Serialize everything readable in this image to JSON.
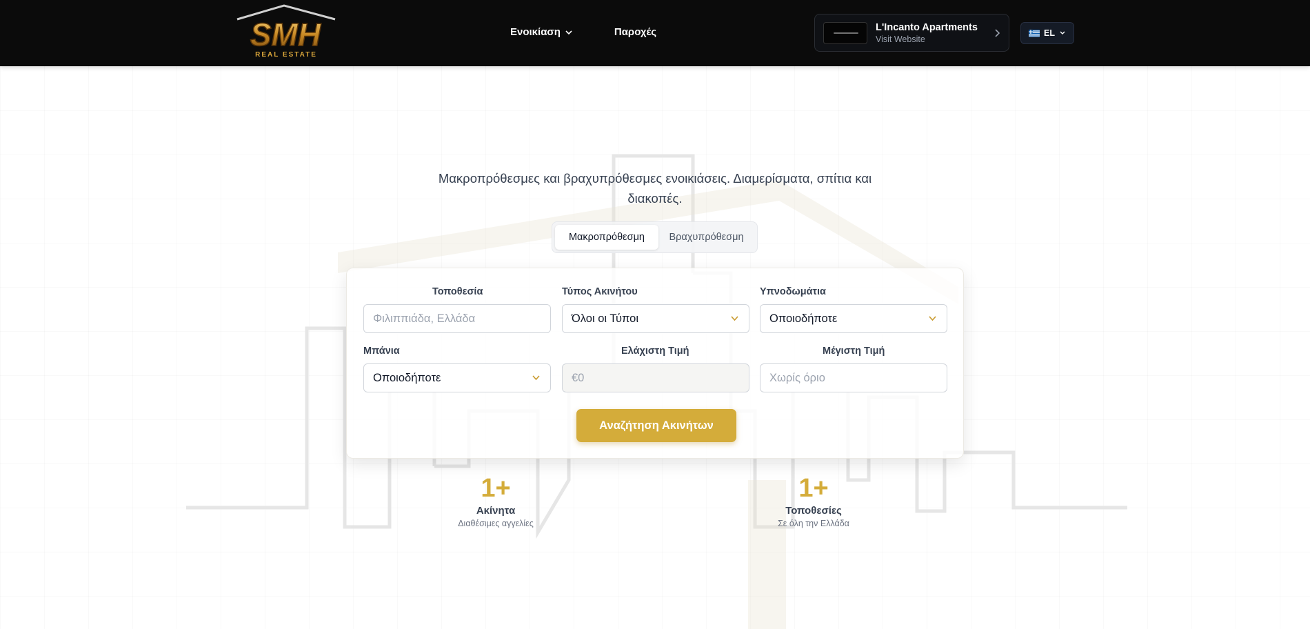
{
  "header": {
    "logo": {
      "text": "SMH",
      "subtitle": "REAL ESTATE"
    },
    "nav": [
      {
        "label": "Ενοικίαση",
        "has_dropdown": true
      },
      {
        "label": "Παροχές",
        "has_dropdown": false
      }
    ],
    "partner": {
      "title": "L'Incanto Apartments",
      "subtitle": "Visit Website",
      "icon": "chevron-right-icon"
    },
    "language": {
      "code": "EL",
      "flag": "greece-flag-icon"
    }
  },
  "hero": {
    "subtitle": "Μακροπρόθεσμες και βραχυπρόθεσμες ενοικιάσεις. Διαμερίσματα, σπίτια και διακοπές."
  },
  "tabs": [
    {
      "label": "Μακροπρόθεσμη",
      "active": true
    },
    {
      "label": "Βραχυπρόθεσμη",
      "active": false
    }
  ],
  "search": {
    "location": {
      "label": "Τοποθεσία",
      "placeholder": "Φιλιππιάδα, Ελλάδα",
      "value": ""
    },
    "property_type": {
      "label": "Τύπος Ακινήτου",
      "value": "Όλοι οι Τύποι"
    },
    "bedrooms": {
      "label": "Υπνοδωμάτια",
      "value": "Οποιοδήποτε"
    },
    "bathrooms": {
      "label": "Μπάνια",
      "value": "Οποιοδήποτε"
    },
    "min_price": {
      "label": "Ελάχιστη Τιμή",
      "placeholder": "€0",
      "value": ""
    },
    "max_price": {
      "label": "Μέγιστη Τιμή",
      "placeholder": "Χωρίς όριο",
      "value": ""
    },
    "button_label": "Αναζήτηση Ακινήτων"
  },
  "stats": [
    {
      "value": "1+",
      "label": "Ακίνητα",
      "description": "Διαθέσιμες αγγελίες"
    },
    {
      "value": "1+",
      "label": "Τοποθεσίες",
      "description": "Σε όλη την Ελλάδα"
    }
  ],
  "colors": {
    "accent": "#d4ac3a",
    "header_bg": "#0b0b0b",
    "logo_gold": "#d9a53a"
  }
}
